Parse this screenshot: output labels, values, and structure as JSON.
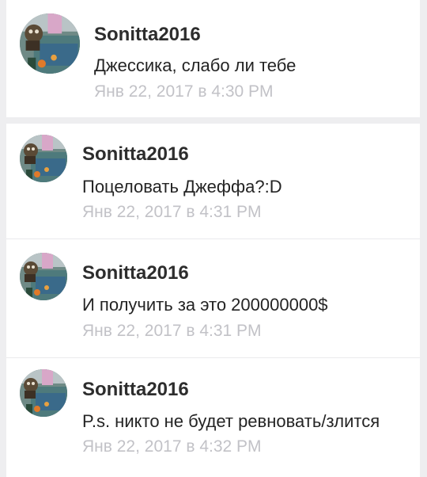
{
  "posts": [
    {
      "username": "Sonitta2016",
      "message": "Джессика, слабо ли тебе",
      "timestamp": "Янв 22, 2017 в 4:30 PM"
    },
    {
      "username": "Sonitta2016",
      "message": "Поцеловать Джеффа?:D",
      "timestamp": "Янв 22, 2017 в 4:31 PM"
    },
    {
      "username": "Sonitta2016",
      "message": "И получить за это 200000000$",
      "timestamp": "Янв 22, 2017 в 4:31 PM"
    },
    {
      "username": "Sonitta2016",
      "message": "P.s. никто не будет ревновать/злится",
      "timestamp": "Янв 22, 2017 в 4:32 PM"
    }
  ]
}
